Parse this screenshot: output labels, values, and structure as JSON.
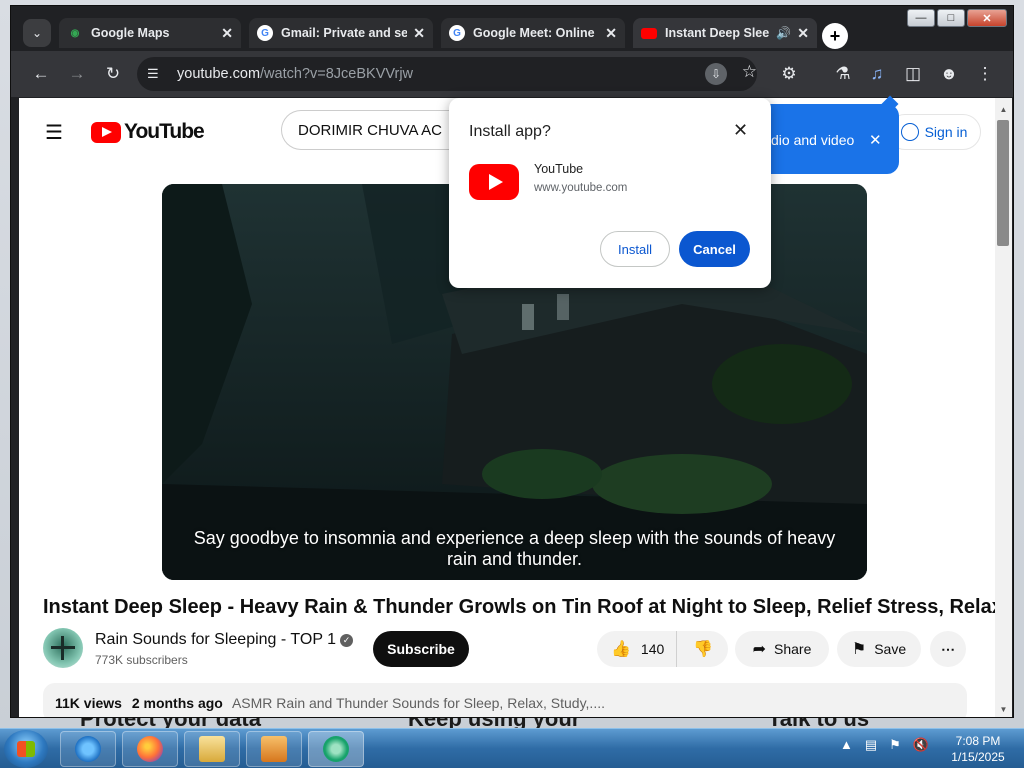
{
  "desktop": {
    "ghost_texts": [
      "Protect your data",
      "Keep using your",
      "Talk to us"
    ]
  },
  "browser": {
    "tabs": [
      {
        "title": "Google Maps",
        "icon": "maps-pin-icon"
      },
      {
        "title": "Gmail: Private and sec",
        "icon": "google-g-icon"
      },
      {
        "title": "Google Meet: Online",
        "icon": "google-g-icon"
      },
      {
        "title": "Instant Deep Sleep",
        "icon": "youtube-icon",
        "active": true,
        "audio": true
      }
    ],
    "url_domain": "youtube.com",
    "url_path": "/watch?v=8JceBKVVrjw"
  },
  "youtube": {
    "logo_text": "YouTube",
    "search_value": "DORIMIR CHUVA AC",
    "signin_label": "Sign in",
    "caption": "Say goodbye to insomnia and experience a deep sleep with the sounds of heavy rain and thunder.",
    "video_title": "Instant Deep Sleep - Heavy Rain & Thunder Growls on Tin Roof at Night to Sleep, Relief Stress, Relax",
    "channel_name": "Rain Sounds for Sleeping - TOP 1",
    "subscribers": "773K subscribers",
    "subscribe_label": "Subscribe",
    "likes": "140",
    "share_label": "Share",
    "save_label": "Save",
    "views": "11K views",
    "posted": "2 months ago",
    "description_preview": "ASMR Rain and Thunder Sounds for Sleep, Relax, Study,...."
  },
  "toast": {
    "text": "dio and video"
  },
  "install_popup": {
    "title": "Install app?",
    "app_name": "YouTube",
    "app_url": "www.youtube.com",
    "install_label": "Install",
    "cancel_label": "Cancel"
  },
  "taskbar": {
    "time": "7:08 PM",
    "date": "1/15/2025"
  },
  "colors": {
    "youtube_red": "#ff0000",
    "chrome_blue": "#0b57d0",
    "toast_blue": "#1a73e8",
    "link_blue": "#065fd4"
  }
}
